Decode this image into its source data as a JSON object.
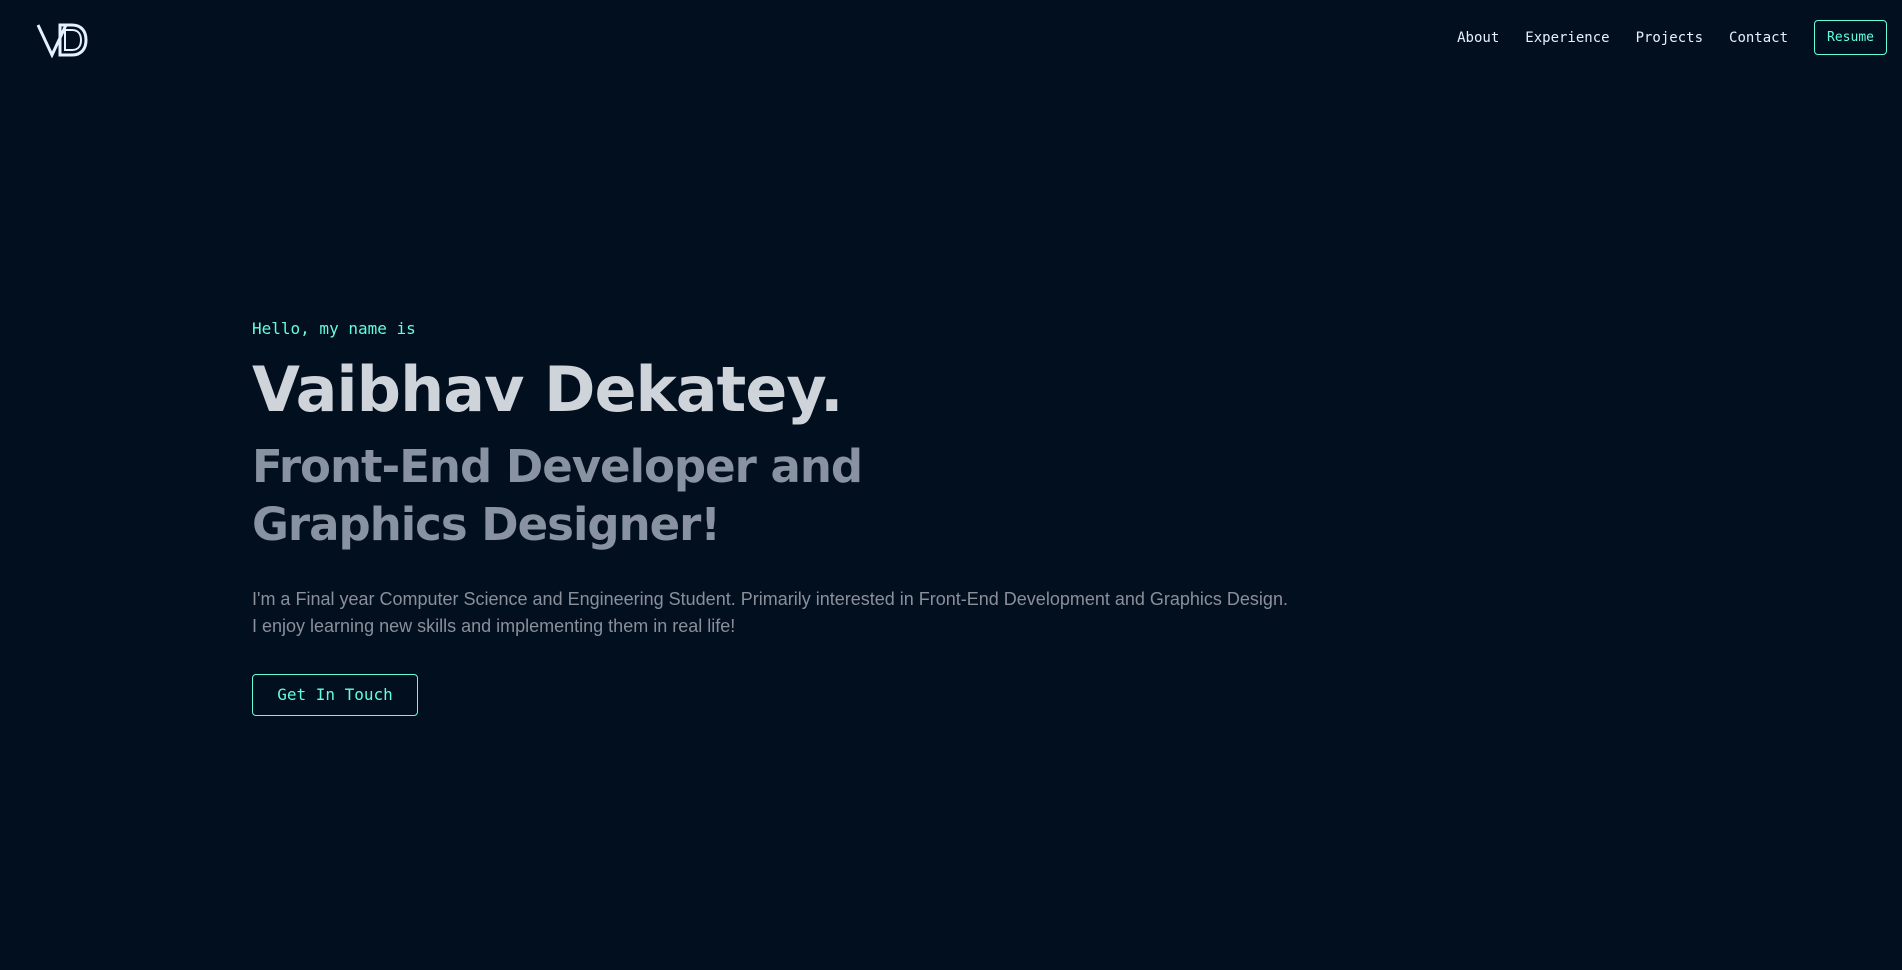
{
  "header": {
    "logo_icon": "vd-monogram-logo-icon",
    "nav": [
      {
        "label": "About"
      },
      {
        "label": "Experience"
      },
      {
        "label": "Projects"
      },
      {
        "label": "Contact"
      }
    ],
    "resume_label": "Resume"
  },
  "hero": {
    "greeting": "Hello, my name is",
    "name": "Vaibhav Dekatey.",
    "tagline_line1": "Front-End Developer and",
    "tagline_line2": "Graphics Designer!",
    "bio_line1": "I'm a Final year Computer Science and Engineering Student. Primarily interested in Front-End Development and Graphics Design.",
    "bio_line2": "I enjoy learning new skills and implementing them in real life!",
    "cta_label": "Get In Touch"
  },
  "colors": {
    "background": "#020f1f",
    "accent": "#64ffda",
    "name_text": "#cfd3da",
    "tagline_text": "#8892a0",
    "body_text": "#8a8f9a",
    "nav_text": "#e6f1ff"
  }
}
